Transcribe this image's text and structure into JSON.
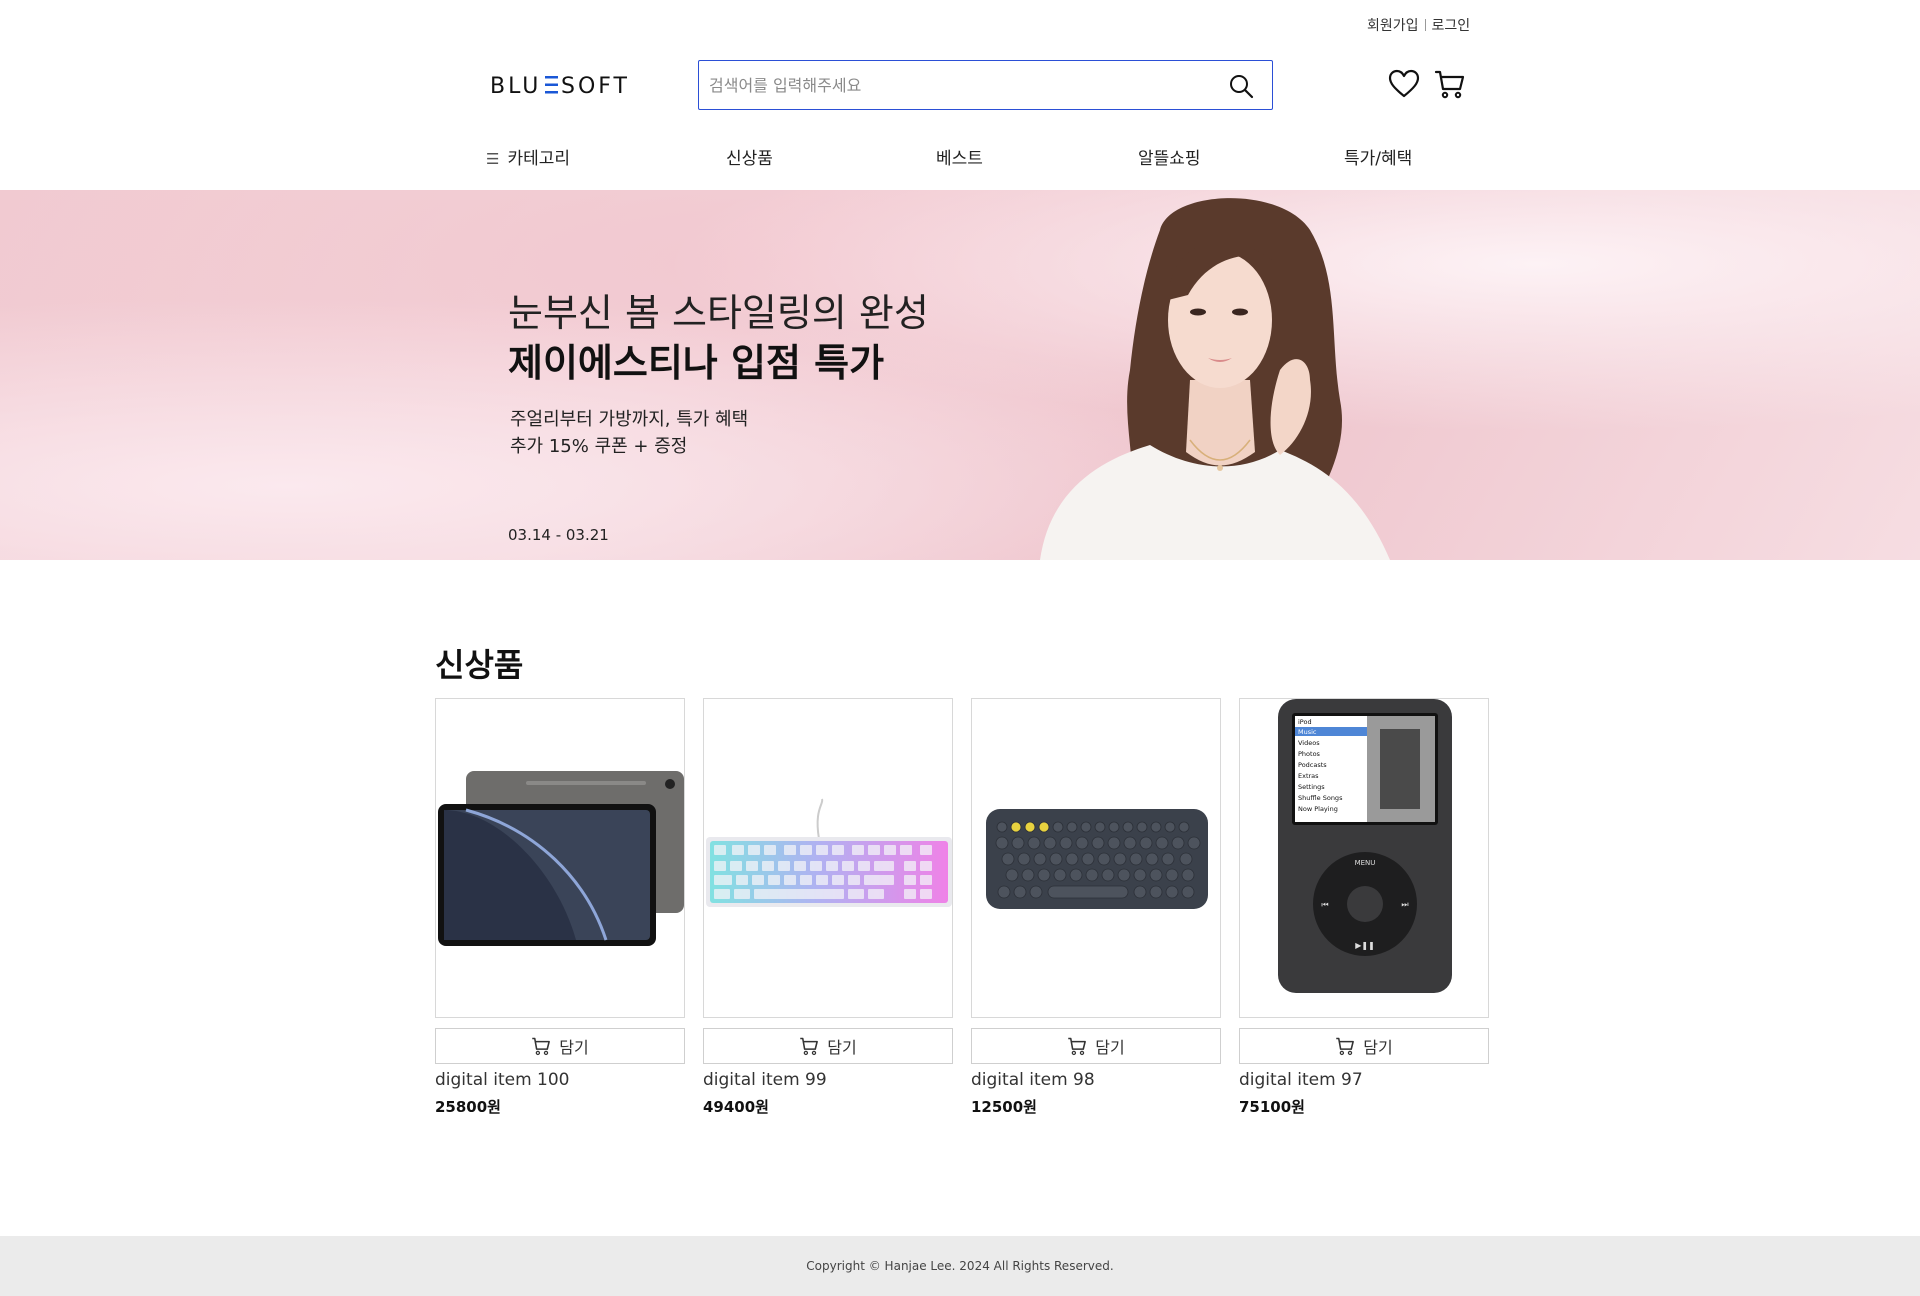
{
  "top_links": {
    "signup": "회원가입",
    "login": "로그인"
  },
  "logo": {
    "text": "BLUESOFT"
  },
  "search": {
    "placeholder": "검색어를 입력해주세요",
    "value": ""
  },
  "header_icons": [
    "heart-icon",
    "cart-icon"
  ],
  "nav": {
    "items": [
      {
        "label": "카테고리",
        "icon": "hamburger-icon"
      },
      {
        "label": "신상품"
      },
      {
        "label": "베스트"
      },
      {
        "label": "알뜰쇼핑"
      },
      {
        "label": "특가/혜택"
      }
    ]
  },
  "banner": {
    "line1": "눈부신 봄 스타일링의 완성",
    "line2": "제이에스티나 입점 특가",
    "line3": "주얼리부터 가방까지, 특가 혜택",
    "line4": "추가 15% 쿠폰 + 증정",
    "date": "03.14 - 03.21"
  },
  "section": {
    "title": "신상품"
  },
  "products": [
    {
      "name": "digital item 100",
      "price": "25800원",
      "cart_label": "담기",
      "image": "tablet"
    },
    {
      "name": "digital item 99",
      "price": "49400원",
      "cart_label": "담기",
      "image": "keyboard-rgb"
    },
    {
      "name": "digital item 98",
      "price": "12500원",
      "cart_label": "담기",
      "image": "keyboard-compact"
    },
    {
      "name": "digital item 97",
      "price": "75100원",
      "cart_label": "담기",
      "image": "ipod-classic"
    }
  ],
  "ipod_screen": {
    "menu_items": [
      "iPod",
      "Music",
      "Videos",
      "Photos",
      "Podcasts",
      "Extras",
      "Settings",
      "Shuffle Songs",
      "Now Playing"
    ],
    "wheel_label": "MENU"
  },
  "footer": {
    "text": "Copyright © Hanjae Lee. 2024 All Rights Reserved."
  },
  "colors": {
    "accent": "#2b4fd6",
    "footer_bg": "#ebebeb",
    "banner_pink": "#f1cad1"
  }
}
